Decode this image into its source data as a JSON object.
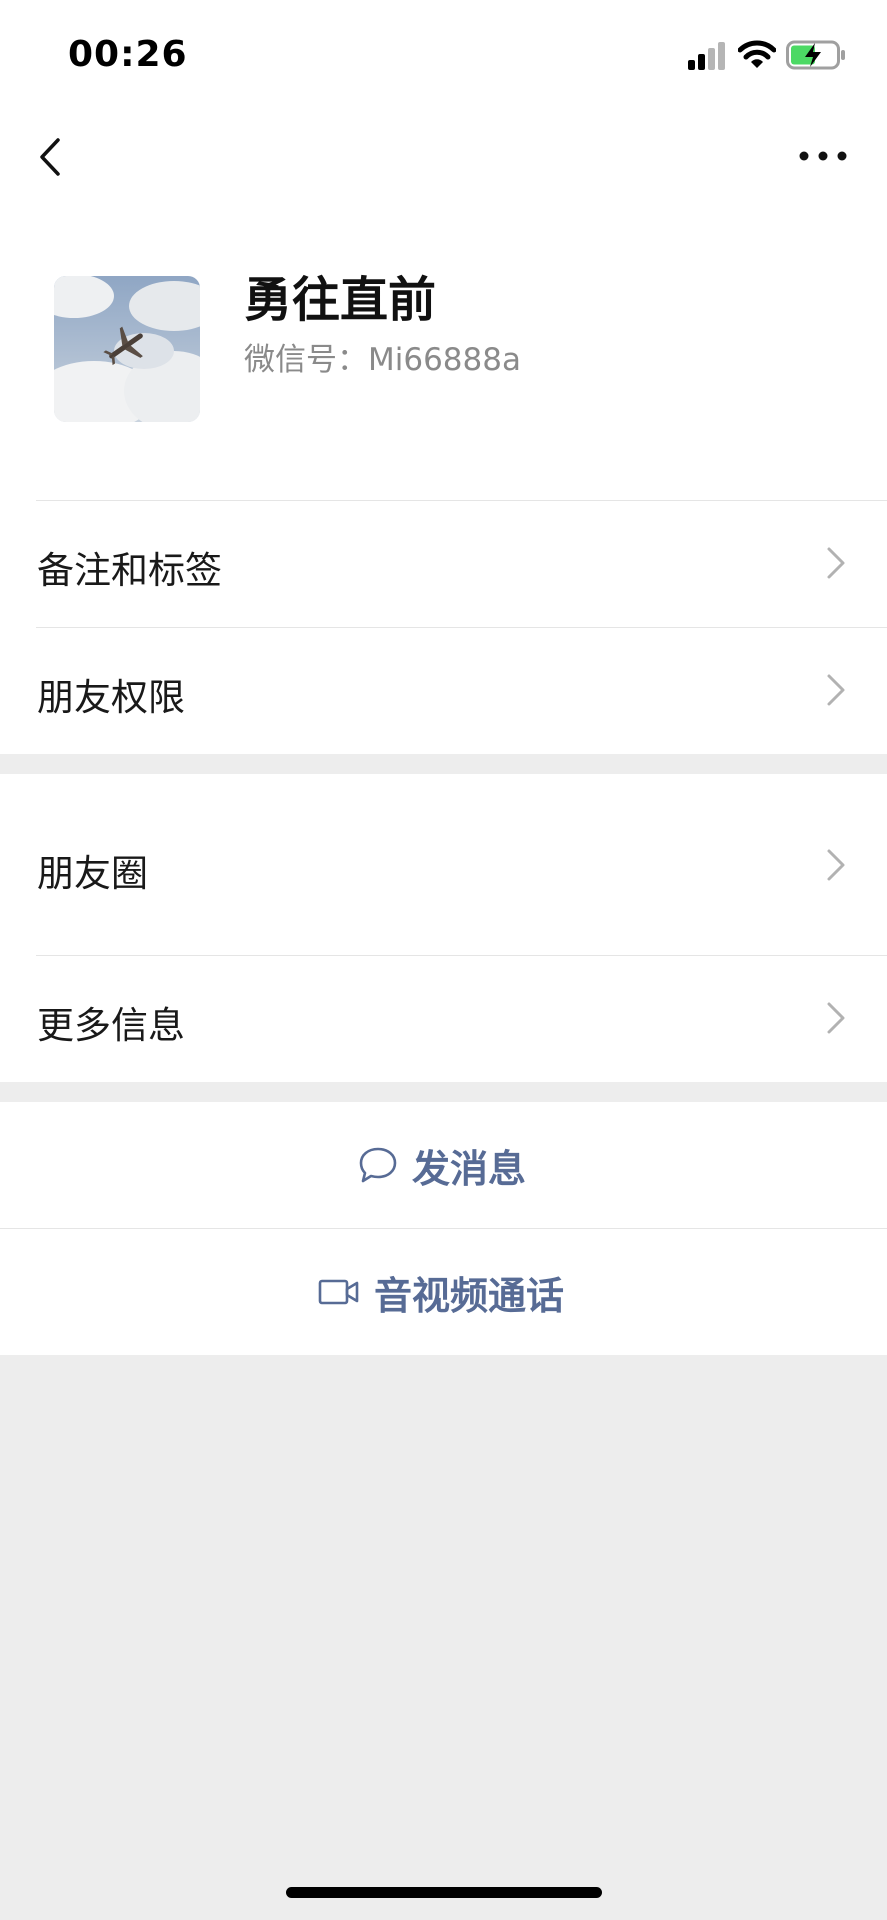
{
  "status_bar": {
    "time": "00:26"
  },
  "profile": {
    "nickname": "勇往直前",
    "wechat_id": "微信号：Mi66888a"
  },
  "sections": {
    "remarks_label": "备注和标签",
    "permissions_label": "朋友权限",
    "moments_label": "朋友圈",
    "more_info_label": "更多信息"
  },
  "actions": {
    "message_label": "发消息",
    "call_label": "音视频通话"
  },
  "colors": {
    "action_blue": "#576b95",
    "background_gray": "#ededed",
    "battery_green": "#4cd964"
  },
  "icons": [
    "signal-icon",
    "wifi-icon",
    "battery-charging-icon",
    "back-icon",
    "more-icon",
    "chevron-right-icon",
    "chat-bubble-icon",
    "video-call-icon"
  ]
}
